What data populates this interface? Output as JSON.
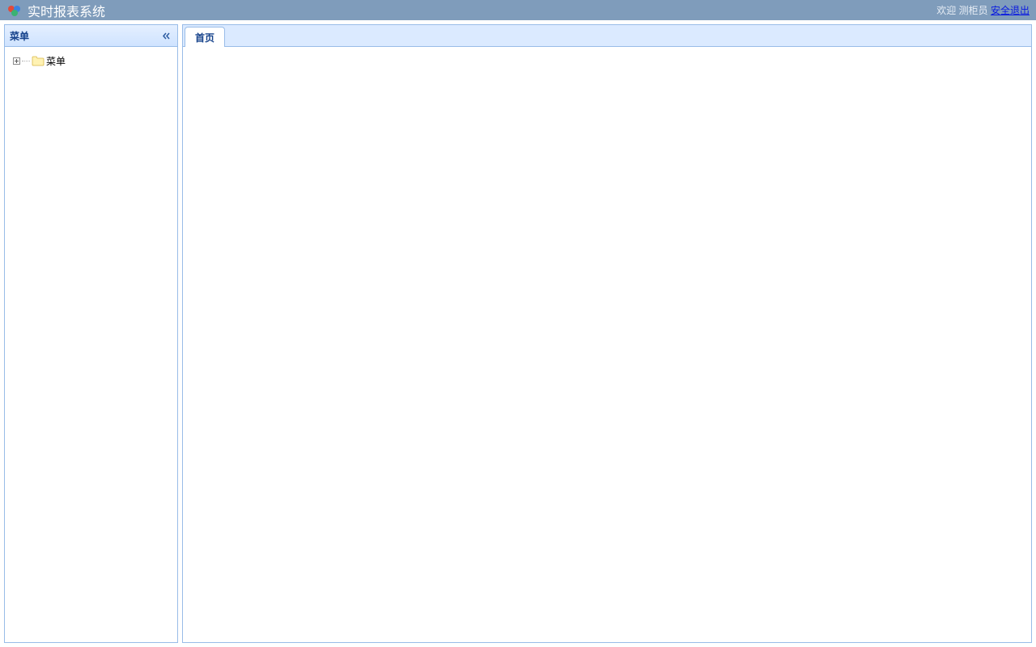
{
  "header": {
    "title": "实时报表系统",
    "welcome_prefix": "欢迎",
    "username": "测柜员",
    "logout_label": "安全退出"
  },
  "sidebar": {
    "title": "菜单",
    "root_node_label": "菜单"
  },
  "tabs": [
    {
      "label": "首页"
    }
  ]
}
